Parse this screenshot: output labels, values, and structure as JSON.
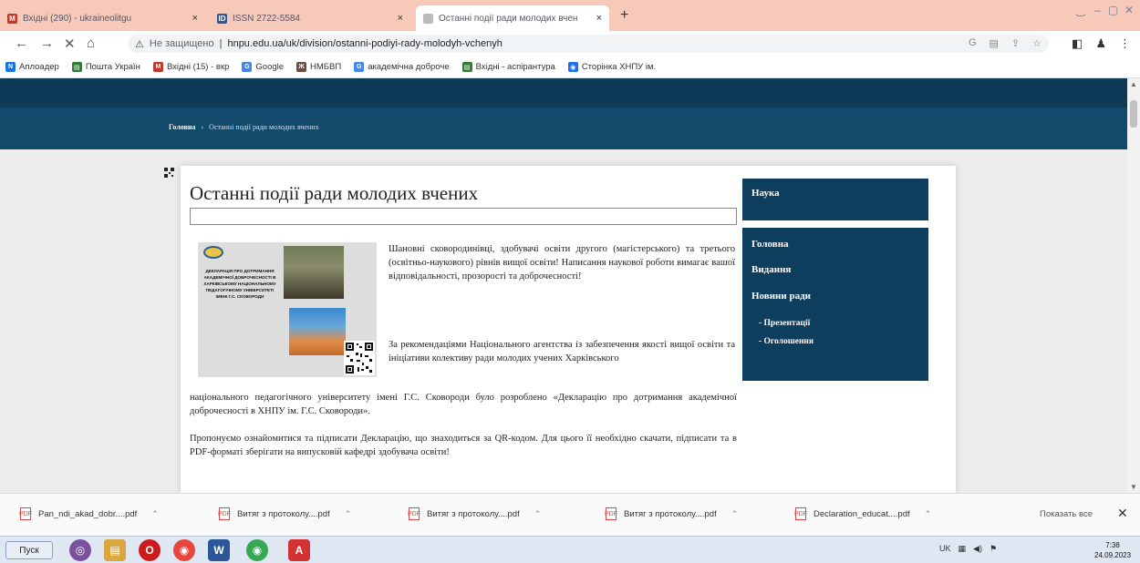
{
  "browser": {
    "tabs": [
      {
        "label": "Вхідні (290) - ukraineolitgu",
        "icon_color": "#c0392b"
      },
      {
        "label": "ISSN 2722-5584",
        "icon_color": "#2b5797"
      },
      {
        "label": "Останні події ради молодих вчен",
        "icon_color": "#bbbbbb"
      }
    ],
    "new_tab": "+",
    "tab_close": "×",
    "window_controls": [
      "‿",
      "–",
      "▢",
      "✕"
    ],
    "nav": {
      "back": "←",
      "forward": "→",
      "reload": "✕",
      "home": "⌂"
    },
    "address": {
      "not_secure": "Не защищено",
      "url": "hnpu.edu.ua/uk/division/ostanni-podiyi-rady-molodyh-vchenyh"
    },
    "omnibox_icons": [
      "G",
      "▤",
      "⇪",
      "☆"
    ],
    "toolbar_icons": [
      "◧",
      "♟",
      "⋮"
    ],
    "bookmarks": [
      {
        "label": "Аплоадер",
        "color": "#1a73e8"
      },
      {
        "label": "Пошта Україн",
        "color": "#2e7d32"
      },
      {
        "label": "Вхідні (15) - вкр",
        "color": "#c0392b"
      },
      {
        "label": "Google",
        "color": "#4285f4"
      },
      {
        "label": "НМБВП",
        "color": "#6d4c41"
      },
      {
        "label": "академічна доброче",
        "color": "#4285f4"
      },
      {
        "label": "Вхідні - аспірантура",
        "color": "#2e7d32"
      },
      {
        "label": "Сторінка ХНПУ ім.",
        "color": "#1a73e8"
      }
    ]
  },
  "site": {
    "breadcrumb": {
      "home": "Головна",
      "sep": "›",
      "current": "Останні події ради молодих вчених"
    },
    "title": "Останні події ради молодих вчених",
    "poster": {
      "text": "ДЕКЛАРАЦІЯ ПРО ДОТРИМАННЯ АКАДЕМІЧНОЇ ДОБРОЧЕСНОСТІ В ХАРКІВСЬКОМУ НАЦІОНАЛЬНОМУ ПЕДАГОГІЧНОМУ УНІВЕРСИТЕТІ ІМЕНІ Г.С. СКОВОРОДИ"
    },
    "paragraph1": "Шановні сковородинівці, здобувачі освіти другого (магістерського) та третього (освітньо-наукового) рівнів вищої освіти! Написання наукової роботи вимагає вашої відповідальності, прозорості та доброчесності!",
    "paragraph2a": "За рекомендаціями Національного агентства із забезпечення якості вищої освіти та ініціативи колективу ради молодих учених Харківського",
    "paragraph2b": "національного педагогічного університету імені Г.С. Сковороди було розроблено «Декларацію про дотримання академічної доброчесності в ХНПУ ім. Г.С. Сковороди».",
    "paragraph3": "Пропонуємо ознайомитися та підписати Декларацію, що знаходиться за QR-кодом. Для цього її необхідно скачати, підписати та в PDF-форматі зберігати на випусковій кафедрі здобувача освіти!",
    "sidebar": {
      "box1_title": "Наука",
      "items": [
        "Головна",
        "Видання",
        "Новини ради"
      ],
      "subitems": [
        "Презентації",
        "Оголошення"
      ]
    }
  },
  "downloads": {
    "items": [
      "Pan_ndi_akad_dobr....pdf",
      "Витяг з протоколу....pdf",
      "Витяг з протоколу....pdf",
      "Витяг з протоколу....pdf",
      "Declaration_educat....pdf"
    ],
    "show_all": "Показать все",
    "close": "✕"
  },
  "taskbar": {
    "start": "Пуск",
    "apps": [
      {
        "name": "viber",
        "glyph": "◎",
        "color": "#7b519d"
      },
      {
        "name": "explorer",
        "glyph": "▤",
        "color": "#d9a640"
      },
      {
        "name": "opera",
        "glyph": "O",
        "color": "#cc1b1b"
      },
      {
        "name": "chrome",
        "glyph": "◉",
        "color": "#e8453c"
      },
      {
        "name": "word",
        "glyph": "W",
        "color": "#2b5797"
      },
      {
        "name": "chrome2",
        "glyph": "◉",
        "color": "#34a853"
      },
      {
        "name": "acrobat",
        "glyph": "A",
        "color": "#d23232"
      }
    ],
    "tray": "UK",
    "time": "7:38",
    "date": "24.09.2023"
  }
}
